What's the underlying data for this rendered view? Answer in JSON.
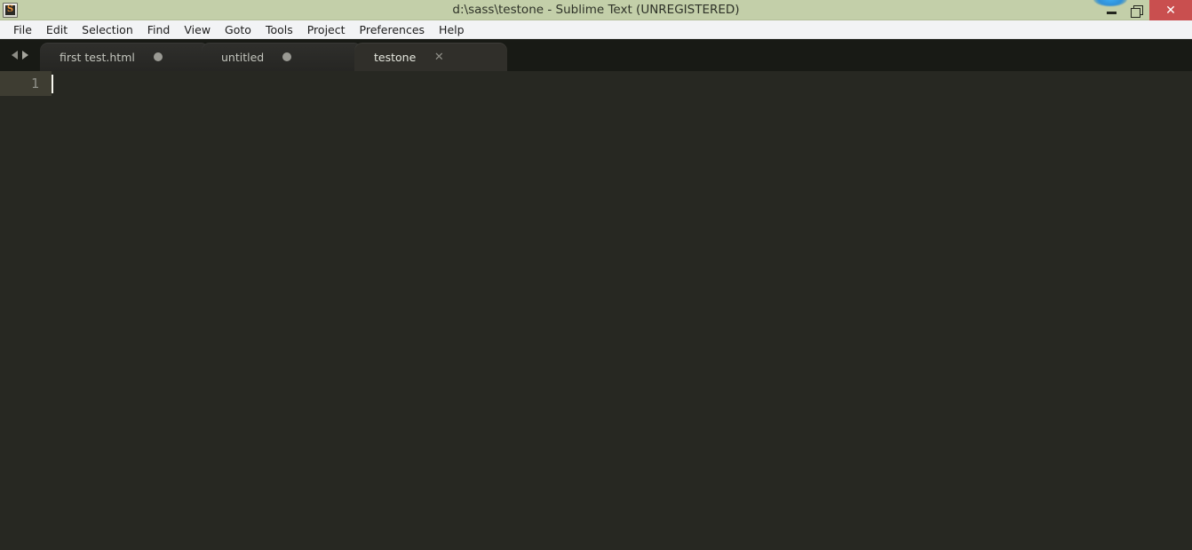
{
  "window": {
    "title": "d:\\sass\\testone - Sublime Text (UNREGISTERED)",
    "app_icon": "S",
    "icon_name": "sublime-text-logo-icon",
    "controls": {
      "minimize_label": "",
      "restore_label": "",
      "close_label": "✕"
    },
    "colors": {
      "titlebar_bg": "#c3cfa9",
      "menubar_bg": "#f2f3f5",
      "tabbar_bg": "#181a15",
      "editor_bg": "#272822",
      "active_line_bg": "#3e3d32",
      "close_button_bg": "#c94f4f",
      "caret": "#f8f8f0"
    }
  },
  "menubar": {
    "items": [
      {
        "label": "File"
      },
      {
        "label": "Edit"
      },
      {
        "label": "Selection"
      },
      {
        "label": "Find"
      },
      {
        "label": "View"
      },
      {
        "label": "Goto"
      },
      {
        "label": "Tools"
      },
      {
        "label": "Project"
      },
      {
        "label": "Preferences"
      },
      {
        "label": "Help"
      }
    ]
  },
  "tabbar": {
    "nav": {
      "prev_icon": "chevron-left-icon",
      "next_icon": "chevron-right-icon"
    },
    "tabs": [
      {
        "label": "first test.html",
        "active": false,
        "dirty": true,
        "indicator": "●"
      },
      {
        "label": "untitled",
        "active": false,
        "dirty": true,
        "indicator": "●"
      },
      {
        "label": "testone",
        "active": true,
        "dirty": false,
        "indicator": "✕"
      }
    ]
  },
  "editor": {
    "line_numbers": [
      "1"
    ],
    "lines": [
      ""
    ],
    "cursor": {
      "line": 1,
      "column": 1
    }
  }
}
